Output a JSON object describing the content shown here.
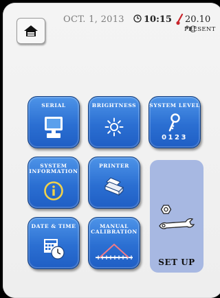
{
  "header": {
    "date": "OCT.  1, 2013",
    "time": "10:15",
    "temperature": "20.10 °C",
    "temperature_label": "PRESENT"
  },
  "tiles": [
    {
      "id": "serial",
      "label": "SERIAL",
      "icon": "monitor-icon"
    },
    {
      "id": "brightness",
      "label": "BRIGHTNESS",
      "icon": "sun-icon"
    },
    {
      "id": "system-level",
      "label": "SYSTEM LEVEL",
      "icon": "key-icon",
      "code": "0123"
    },
    {
      "id": "system-information",
      "label_line1": "SYSTEM",
      "label_line2": "INFORMATION",
      "icon": "info-icon"
    },
    {
      "id": "printer",
      "label": "PRINTER",
      "icon": "printer-icon"
    },
    {
      "id": "date-time",
      "label": "DATE & TIME",
      "icon": "calendar-clock-icon"
    },
    {
      "id": "manual-calibration",
      "label_line1": "MANUAL",
      "label_line2": "CALIBRATION",
      "icon": "calibration-curve-icon"
    }
  ],
  "setup": {
    "label": "SET UP",
    "icon": "wrench-nut-icon"
  },
  "colors": {
    "tile_blue": "#2b6fd2",
    "tile_border": "#123c7c",
    "setup_bg": "#a7b8e2",
    "panel_bg": "#f1f1f1"
  }
}
